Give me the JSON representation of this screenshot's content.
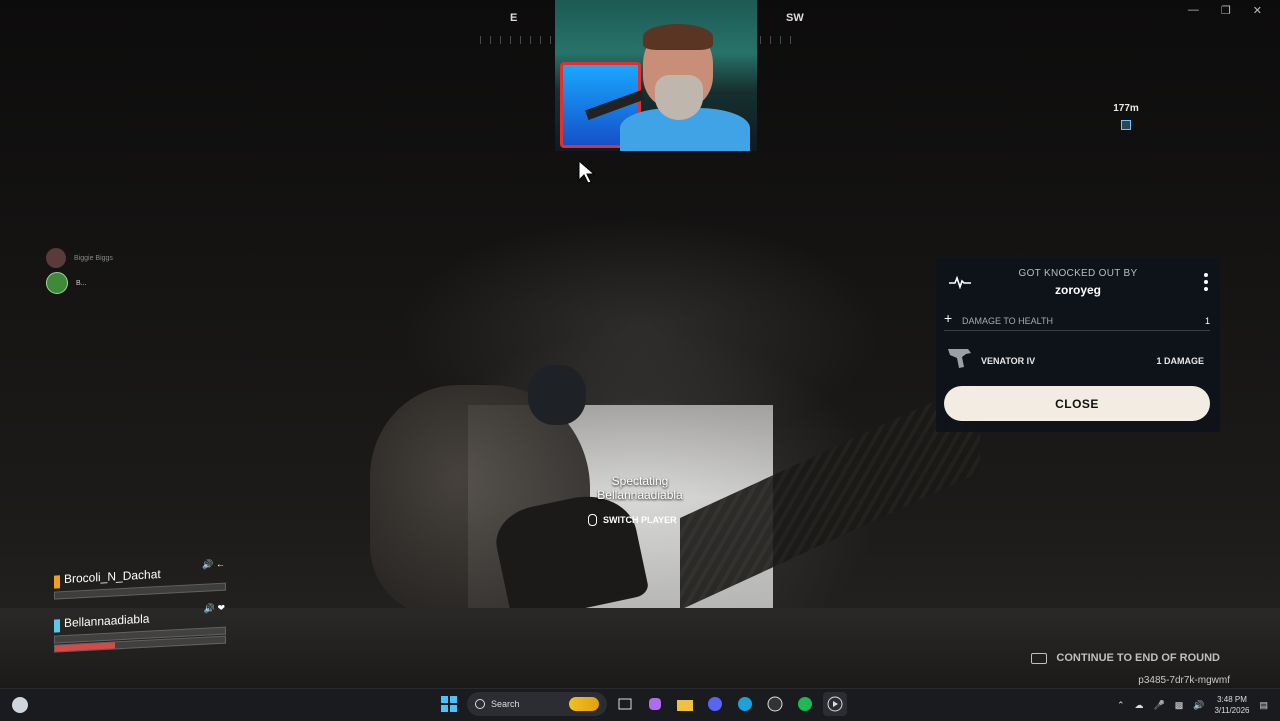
{
  "hud": {
    "compass": {
      "left_dir": "E",
      "right_dir": "SW"
    },
    "marker_distance": "177m",
    "spectating_label": "Spectating",
    "spectating_player": "Bellannaadiabla",
    "switch_player_label": "SWITCH PLAYER",
    "continue_label": "CONTINUE TO END OF ROUND",
    "session_code": "p3485-7dr7k-mgwmf"
  },
  "squad": [
    {
      "name": "Biggie Biggs"
    },
    {
      "name": "B..."
    }
  ],
  "knockout": {
    "title": "GOT KNOCKED OUT BY",
    "killer": "zoroyeg",
    "damage_label": "DAMAGE TO HEALTH",
    "damage_value": "1",
    "weapon_name": "VENATOR IV",
    "weapon_damage": "1 DAMAGE",
    "close_label": "CLOSE"
  },
  "teammates": [
    {
      "name": "Brocoli_N_Dachat",
      "color": "#f0a020",
      "health": 0
    },
    {
      "name": "Bellannaadiabla",
      "color": "#5ec8e8",
      "health": 0.35
    }
  ],
  "taskbar": {
    "search_placeholder": "Search",
    "time": "3:48 PM",
    "date": "3/11/2026"
  },
  "icons": [
    "windows-start-icon",
    "search-icon",
    "file-explorer-icon",
    "discord-icon",
    "edge-icon",
    "spotify-icon",
    "media-player-icon",
    "wifi-icon",
    "volume-icon",
    "notification-icon"
  ]
}
